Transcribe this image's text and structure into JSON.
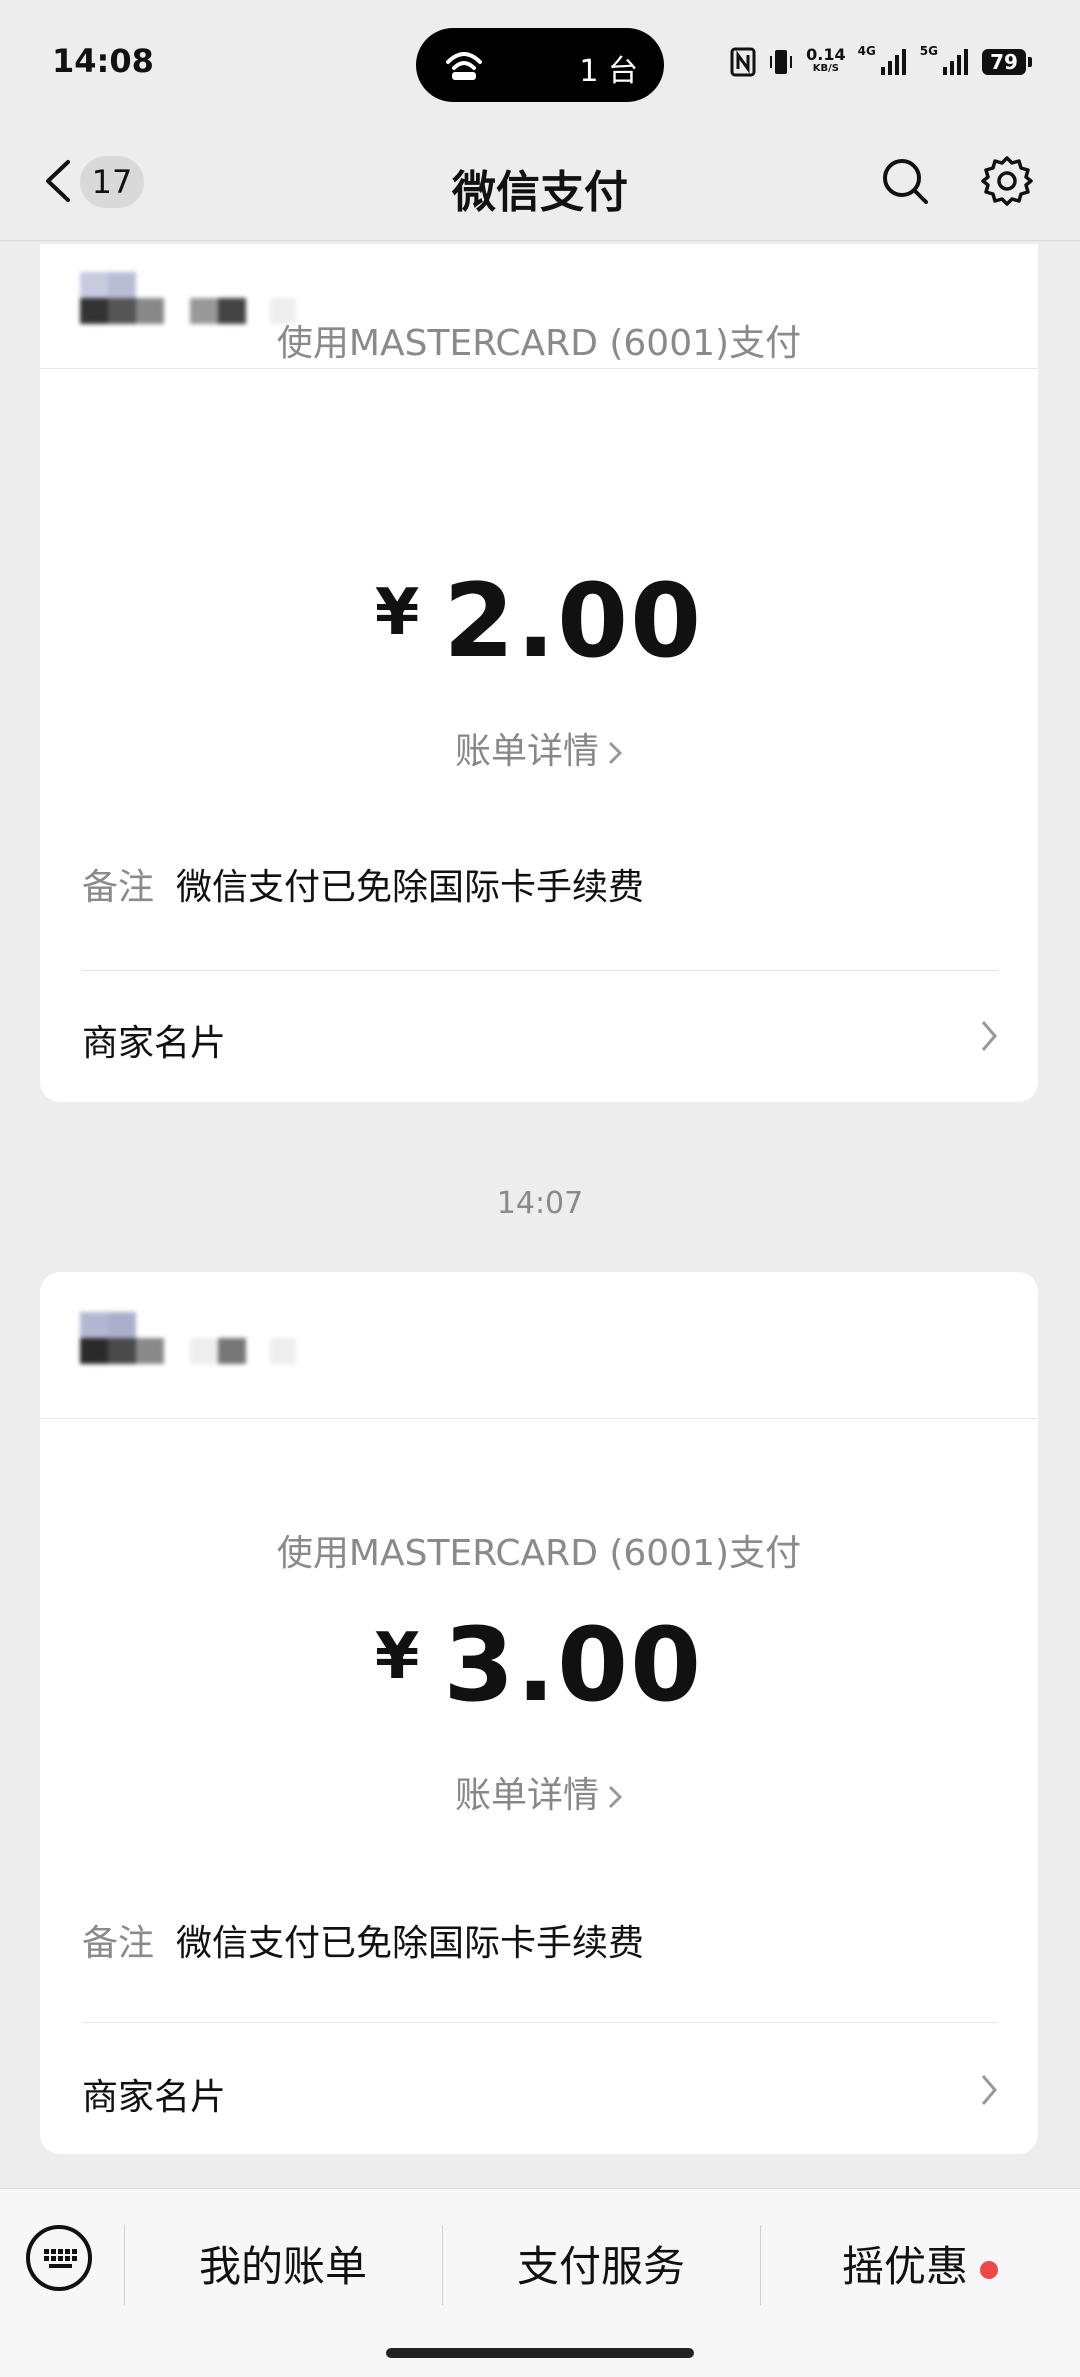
{
  "status_bar": {
    "time": "14:08",
    "cast_count": "1 台",
    "net_speed": "0.14",
    "net_unit": "KB/S",
    "net_4g": "4G",
    "net_5g": "5G",
    "battery": "79"
  },
  "nav": {
    "back_count": "17",
    "title": "微信支付"
  },
  "payments": [
    {
      "pay_method": "使用MASTERCARD (6001)支付",
      "currency": "¥",
      "amount": "2.00",
      "bill_detail": "账单详情",
      "note_label": "备注",
      "note_text": "微信支付已免除国际卡手续费",
      "merchant_card": "商家名片"
    },
    {
      "pay_method": "使用MASTERCARD (6001)支付",
      "currency": "¥",
      "amount": "3.00",
      "bill_detail": "账单详情",
      "note_label": "备注",
      "note_text": "微信支付已免除国际卡手续费",
      "merchant_card": "商家名片"
    }
  ],
  "timestamp": "14:07",
  "bottom_bar": {
    "tab1": "我的账单",
    "tab2": "支付服务",
    "tab3": "摇优惠"
  }
}
